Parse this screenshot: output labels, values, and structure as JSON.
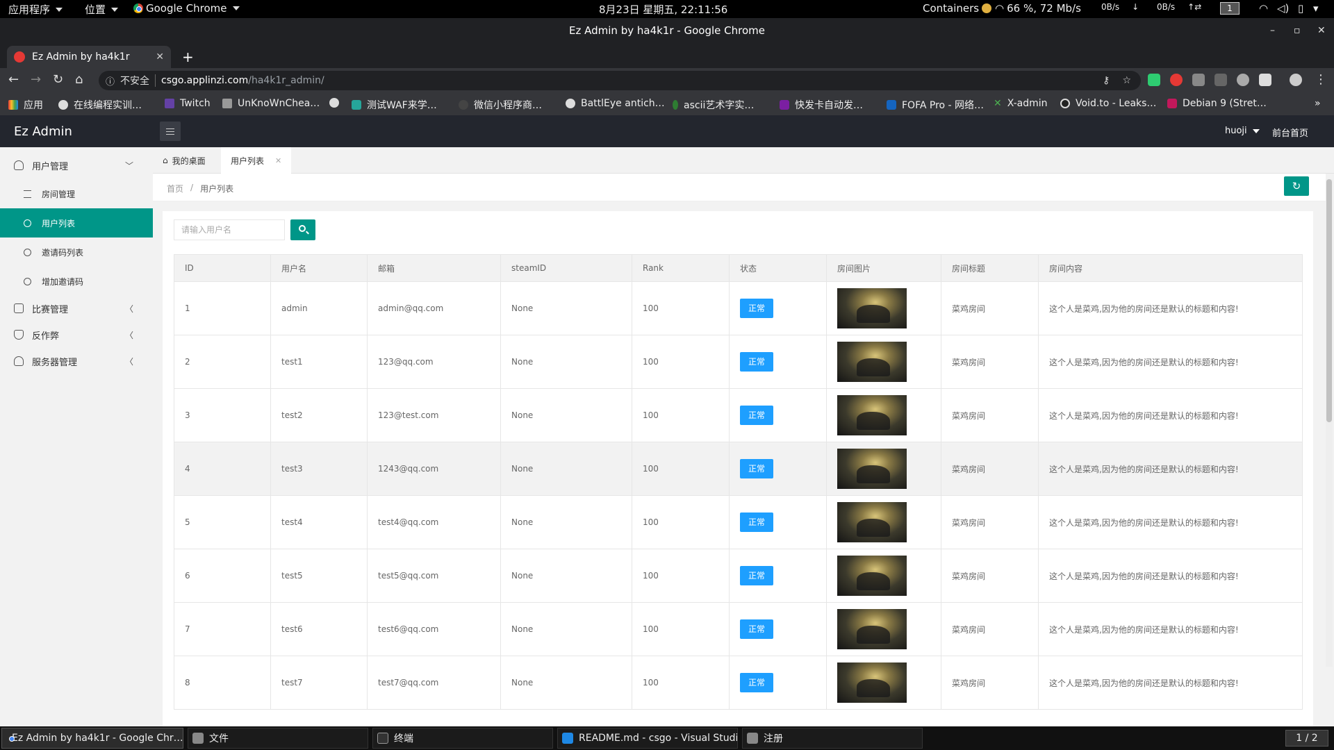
{
  "os_panel": {
    "apps_menu": "应用程序",
    "places_menu": "位置",
    "browser_menu": "Google Chrome",
    "clock": "8月23日 星期五, 22:11:56",
    "containers": "Containers",
    "wifi": "66 %, 72 Mb/s",
    "net_down": "0B/s",
    "net_up": "0B/s",
    "workspace": "1"
  },
  "window": {
    "title": "Ez Admin by ha4k1r - Google Chrome"
  },
  "browser": {
    "tab_title": "Ez Admin by ha4k1r",
    "security_label": "不安全",
    "url_host": "csgo.applinzi.com",
    "url_path": "/ha4k1r_admin/",
    "bookmarks": [
      "应用",
      "在线编程实训…",
      "Twitch",
      "UnKnoWnChea…",
      "",
      "测试WAF来学…",
      "微信小程序商…",
      "BattlEye antich…",
      "ascii艺术字实…",
      "快发卡自动发…",
      "FOFA Pro - 网络…",
      "X-admin",
      "Void.to - Leaks…",
      "Debian 9 (Stret…"
    ]
  },
  "app": {
    "logo": "Ez Admin",
    "user": "huoji",
    "front_link": "前台首页"
  },
  "sidebar": {
    "user_mgmt": "用户管理",
    "room_mgmt": "房间管理",
    "user_list": "用户列表",
    "invite_list": "邀请码列表",
    "add_invite": "增加邀请码",
    "match_mgmt": "比赛管理",
    "anticheat": "反作弊",
    "server_mgmt": "服务器管理"
  },
  "page_tabs": {
    "home": "我的桌面",
    "user_list": "用户列表"
  },
  "breadcrumb": {
    "home": "首页",
    "current": "用户列表"
  },
  "search": {
    "placeholder": "请输入用户名"
  },
  "table": {
    "headers": [
      "ID",
      "用户名",
      "邮箱",
      "steamID",
      "Rank",
      "状态",
      "房间图片",
      "房间标题",
      "房间内容"
    ],
    "rows": [
      {
        "id": "1",
        "username": "admin",
        "email": "admin@qq.com",
        "steamid": "None",
        "rank": "100",
        "status": "正常",
        "title": "菜鸡房间",
        "content": "这个人是菜鸡,因为他的房间还是默认的标题和内容!"
      },
      {
        "id": "2",
        "username": "test1",
        "email": "123@qq.com",
        "steamid": "None",
        "rank": "100",
        "status": "正常",
        "title": "菜鸡房间",
        "content": "这个人是菜鸡,因为他的房间还是默认的标题和内容!"
      },
      {
        "id": "3",
        "username": "test2",
        "email": "123@test.com",
        "steamid": "None",
        "rank": "100",
        "status": "正常",
        "title": "菜鸡房间",
        "content": "这个人是菜鸡,因为他的房间还是默认的标题和内容!"
      },
      {
        "id": "4",
        "username": "test3",
        "email": "1243@qq.com",
        "steamid": "None",
        "rank": "100",
        "status": "正常",
        "title": "菜鸡房间",
        "content": "这个人是菜鸡,因为他的房间还是默认的标题和内容!"
      },
      {
        "id": "5",
        "username": "test4",
        "email": "test4@qq.com",
        "steamid": "None",
        "rank": "100",
        "status": "正常",
        "title": "菜鸡房间",
        "content": "这个人是菜鸡,因为他的房间还是默认的标题和内容!"
      },
      {
        "id": "6",
        "username": "test5",
        "email": "test5@qq.com",
        "steamid": "None",
        "rank": "100",
        "status": "正常",
        "title": "菜鸡房间",
        "content": "这个人是菜鸡,因为他的房间还是默认的标题和内容!"
      },
      {
        "id": "7",
        "username": "test6",
        "email": "test6@qq.com",
        "steamid": "None",
        "rank": "100",
        "status": "正常",
        "title": "菜鸡房间",
        "content": "这个人是菜鸡,因为他的房间还是默认的标题和内容!"
      },
      {
        "id": "8",
        "username": "test7",
        "email": "test7@qq.com",
        "steamid": "None",
        "rank": "100",
        "status": "正常",
        "title": "菜鸡房间",
        "content": "这个人是菜鸡,因为他的房间还是默认的标题和内容!"
      }
    ]
  },
  "taskbar": {
    "tasks": [
      "Ez Admin by ha4k1r - Google Chr…",
      "文件",
      "终端",
      "README.md - csgo - Visual Studi…",
      "注册"
    ],
    "pager": "1 / 2"
  },
  "colors": {
    "accent": "#009688",
    "status_blue": "#1e9fff",
    "header_dark": "#23262e"
  }
}
